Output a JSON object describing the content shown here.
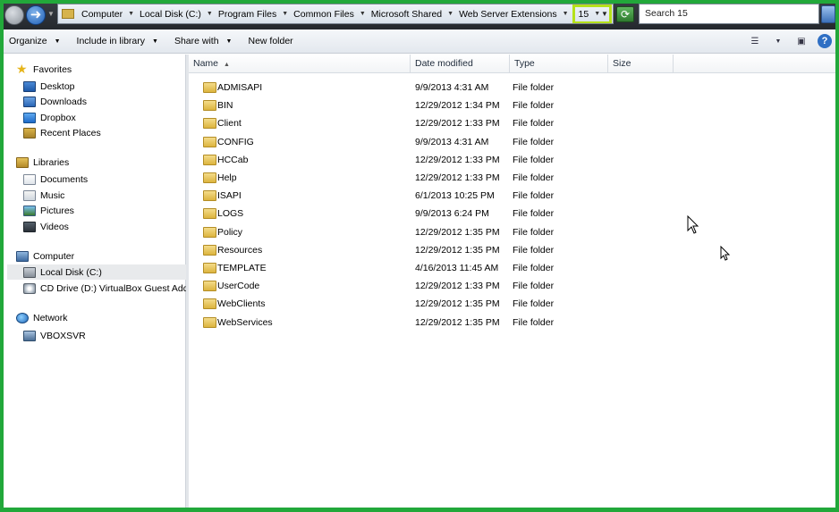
{
  "address_bar": {
    "breadcrumbs": [
      "Computer",
      "Local Disk (C:)",
      "Program Files",
      "Common Files",
      "Microsoft Shared",
      "Web Server Extensions"
    ],
    "current": "15",
    "search_placeholder": "Search 15"
  },
  "toolbar": {
    "organize": "Organize",
    "include_in_library": "Include in library",
    "share_with": "Share with",
    "new_folder": "New folder"
  },
  "nav": {
    "favorites": {
      "label": "Favorites",
      "items": [
        "Desktop",
        "Downloads",
        "Dropbox",
        "Recent Places"
      ]
    },
    "libraries": {
      "label": "Libraries",
      "items": [
        "Documents",
        "Music",
        "Pictures",
        "Videos"
      ]
    },
    "computer": {
      "label": "Computer",
      "items": [
        "Local Disk (C:)",
        "CD Drive (D:) VirtualBox Guest Additi"
      ]
    },
    "network": {
      "label": "Network",
      "items": [
        "VBOXSVR"
      ]
    }
  },
  "columns": {
    "name": "Name",
    "date": "Date modified",
    "type": "Type",
    "size": "Size"
  },
  "files": [
    {
      "name": "ADMISAPI",
      "date": "9/9/2013 4:31 AM",
      "type": "File folder"
    },
    {
      "name": "BIN",
      "date": "12/29/2012 1:34 PM",
      "type": "File folder"
    },
    {
      "name": "Client",
      "date": "12/29/2012 1:33 PM",
      "type": "File folder"
    },
    {
      "name": "CONFIG",
      "date": "9/9/2013 4:31 AM",
      "type": "File folder"
    },
    {
      "name": "HCCab",
      "date": "12/29/2012 1:33 PM",
      "type": "File folder"
    },
    {
      "name": "Help",
      "date": "12/29/2012 1:33 PM",
      "type": "File folder"
    },
    {
      "name": "ISAPI",
      "date": "6/1/2013 10:25 PM",
      "type": "File folder"
    },
    {
      "name": "LOGS",
      "date": "9/9/2013 6:24 PM",
      "type": "File folder"
    },
    {
      "name": "Policy",
      "date": "12/29/2012 1:35 PM",
      "type": "File folder"
    },
    {
      "name": "Resources",
      "date": "12/29/2012 1:35 PM",
      "type": "File folder"
    },
    {
      "name": "TEMPLATE",
      "date": "4/16/2013 11:45 AM",
      "type": "File folder"
    },
    {
      "name": "UserCode",
      "date": "12/29/2012 1:33 PM",
      "type": "File folder"
    },
    {
      "name": "WebClients",
      "date": "12/29/2012 1:35 PM",
      "type": "File folder"
    },
    {
      "name": "WebServices",
      "date": "12/29/2012 1:35 PM",
      "type": "File folder"
    }
  ],
  "colors": {
    "highlight_border": "#b5e11a",
    "frame_border": "#22a83a"
  }
}
